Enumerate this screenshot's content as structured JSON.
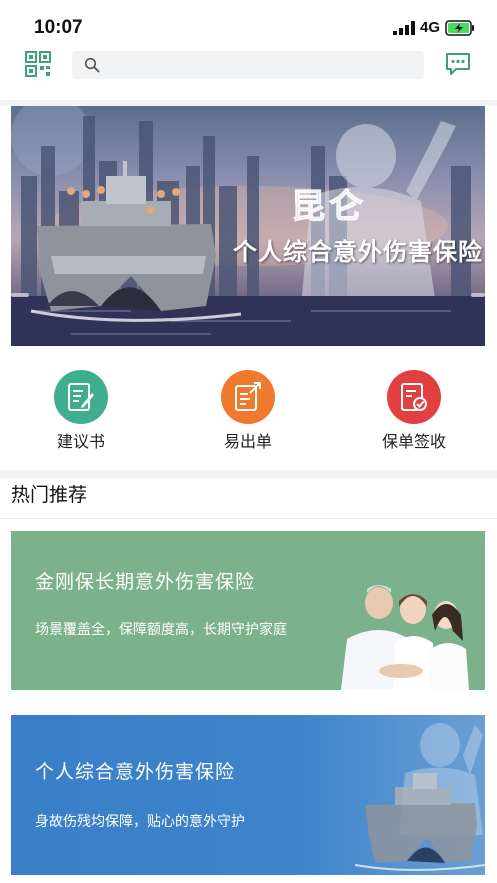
{
  "status_bar": {
    "time": "10:07",
    "network": "4G"
  },
  "search": {
    "placeholder": ""
  },
  "banner": {
    "brand": "昆仑",
    "title": "个人综合意外伤害保险"
  },
  "quick_actions": [
    {
      "label": "建议书",
      "icon": "proposal-icon",
      "color": "#3fae8f"
    },
    {
      "label": "易出单",
      "icon": "easy-issue-icon",
      "color": "#ef7a2e"
    },
    {
      "label": "保单签收",
      "icon": "policy-sign-icon",
      "color": "#e0403f"
    }
  ],
  "hot": {
    "title": "热门推荐"
  },
  "products": [
    {
      "title": "金刚保长期意外伤害保险",
      "desc": "场景覆盖全，保障额度高，长期守护家庭",
      "color": "#7cb28b"
    },
    {
      "title": "个人综合意外伤害保险",
      "desc": "身故伤残均保障，贴心的意外守护",
      "color": "#3d84cb"
    }
  ]
}
